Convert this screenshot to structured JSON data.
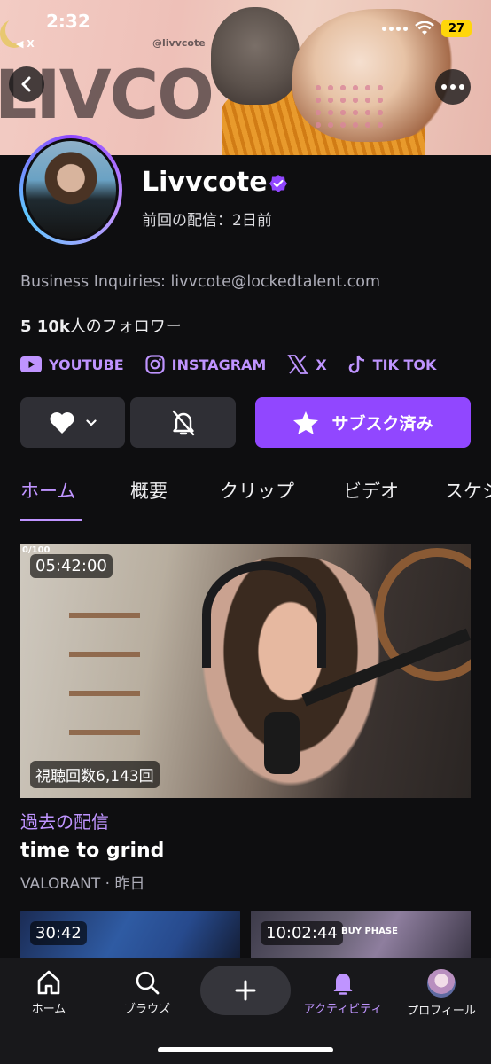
{
  "status": {
    "time": "2:32",
    "back_app": "◀ X",
    "battery": "27"
  },
  "banner": {
    "handle": "@livvcote",
    "stroke_text": "LIVCOTE"
  },
  "profile": {
    "name": "Livvcote",
    "last_stream": "前回の配信：2日前",
    "bio": "Business Inquiries: livvcote@lockedtalent.com",
    "followers_count": "5 10k",
    "followers_suffix": "人のフォロワー"
  },
  "socials": [
    {
      "label": "YOUTUBE",
      "icon": "youtube-icon"
    },
    {
      "label": "INSTAGRAM",
      "icon": "instagram-icon"
    },
    {
      "label": "X",
      "icon": "x-icon"
    },
    {
      "label": "TIK TOK",
      "icon": "tiktok-icon"
    }
  ],
  "actions": {
    "subscribe_label": "サブスク済み"
  },
  "tabs": [
    "ホーム",
    "概要",
    "クリップ",
    "ビデオ",
    "スケジ"
  ],
  "featured_video": {
    "progress_label": "0/100",
    "duration": "05:42:00",
    "views": "視聴回数6,143回",
    "section_label": "過去の配信",
    "title": "time to grind",
    "meta": "VALORANT · 昨日"
  },
  "thumbnails": [
    {
      "duration": "30:42"
    },
    {
      "duration": "10:02:44",
      "overlay": "BUY PHASE"
    }
  ],
  "bottom_nav": [
    {
      "label": "ホーム",
      "icon": "home-icon"
    },
    {
      "label": "ブラウズ",
      "icon": "search-icon"
    },
    {
      "label": "アクティビティ",
      "icon": "bell-icon"
    },
    {
      "label": "プロフィール",
      "icon": "avatar"
    }
  ],
  "colors": {
    "accent": "#9147ff",
    "accent_text": "#bf94ff",
    "background": "#0e0e10"
  }
}
